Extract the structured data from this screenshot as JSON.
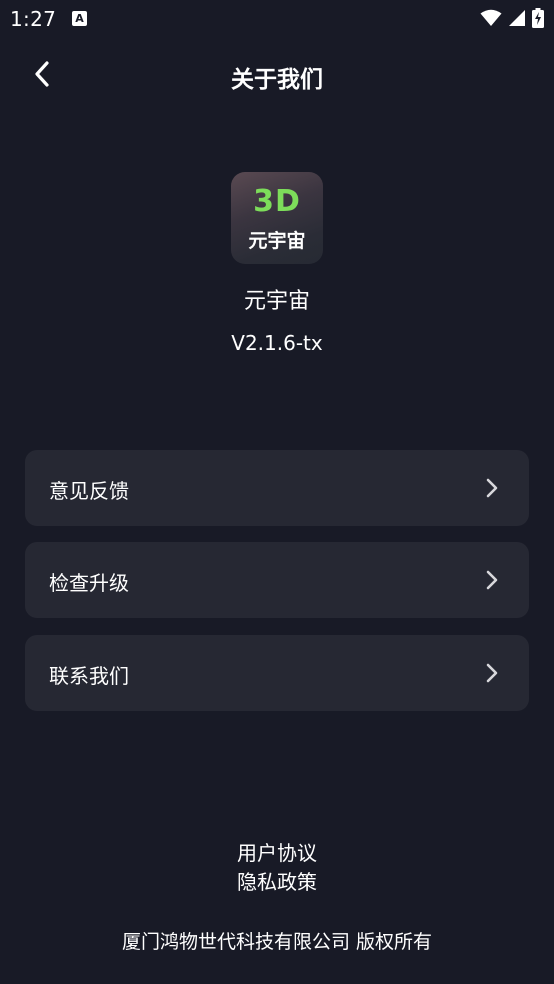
{
  "status_bar": {
    "time": "1:27",
    "notification_icon": "A",
    "icons": [
      "wifi-icon",
      "signal-icon",
      "battery-charging-icon"
    ]
  },
  "header": {
    "back_icon": "chevron-left-icon",
    "title": "关于我们"
  },
  "app": {
    "logo_text_top": "3D",
    "logo_text_bottom": "元宇宙",
    "name": "元宇宙",
    "version": "V2.1.6-tx"
  },
  "menu": [
    {
      "label": "意见反馈",
      "icon": "chevron-right-icon"
    },
    {
      "label": "检查升级",
      "icon": "chevron-right-icon"
    },
    {
      "label": "联系我们",
      "icon": "chevron-right-icon"
    }
  ],
  "footer": {
    "user_agreement": "用户协议",
    "privacy_policy": "隐私政策",
    "copyright": "厦门鸿物世代科技有限公司 版权所有"
  },
  "colors": {
    "background": "#181a26",
    "card": "#262833",
    "text": "#ffffff",
    "logo_accent": "#7ddd5a"
  }
}
